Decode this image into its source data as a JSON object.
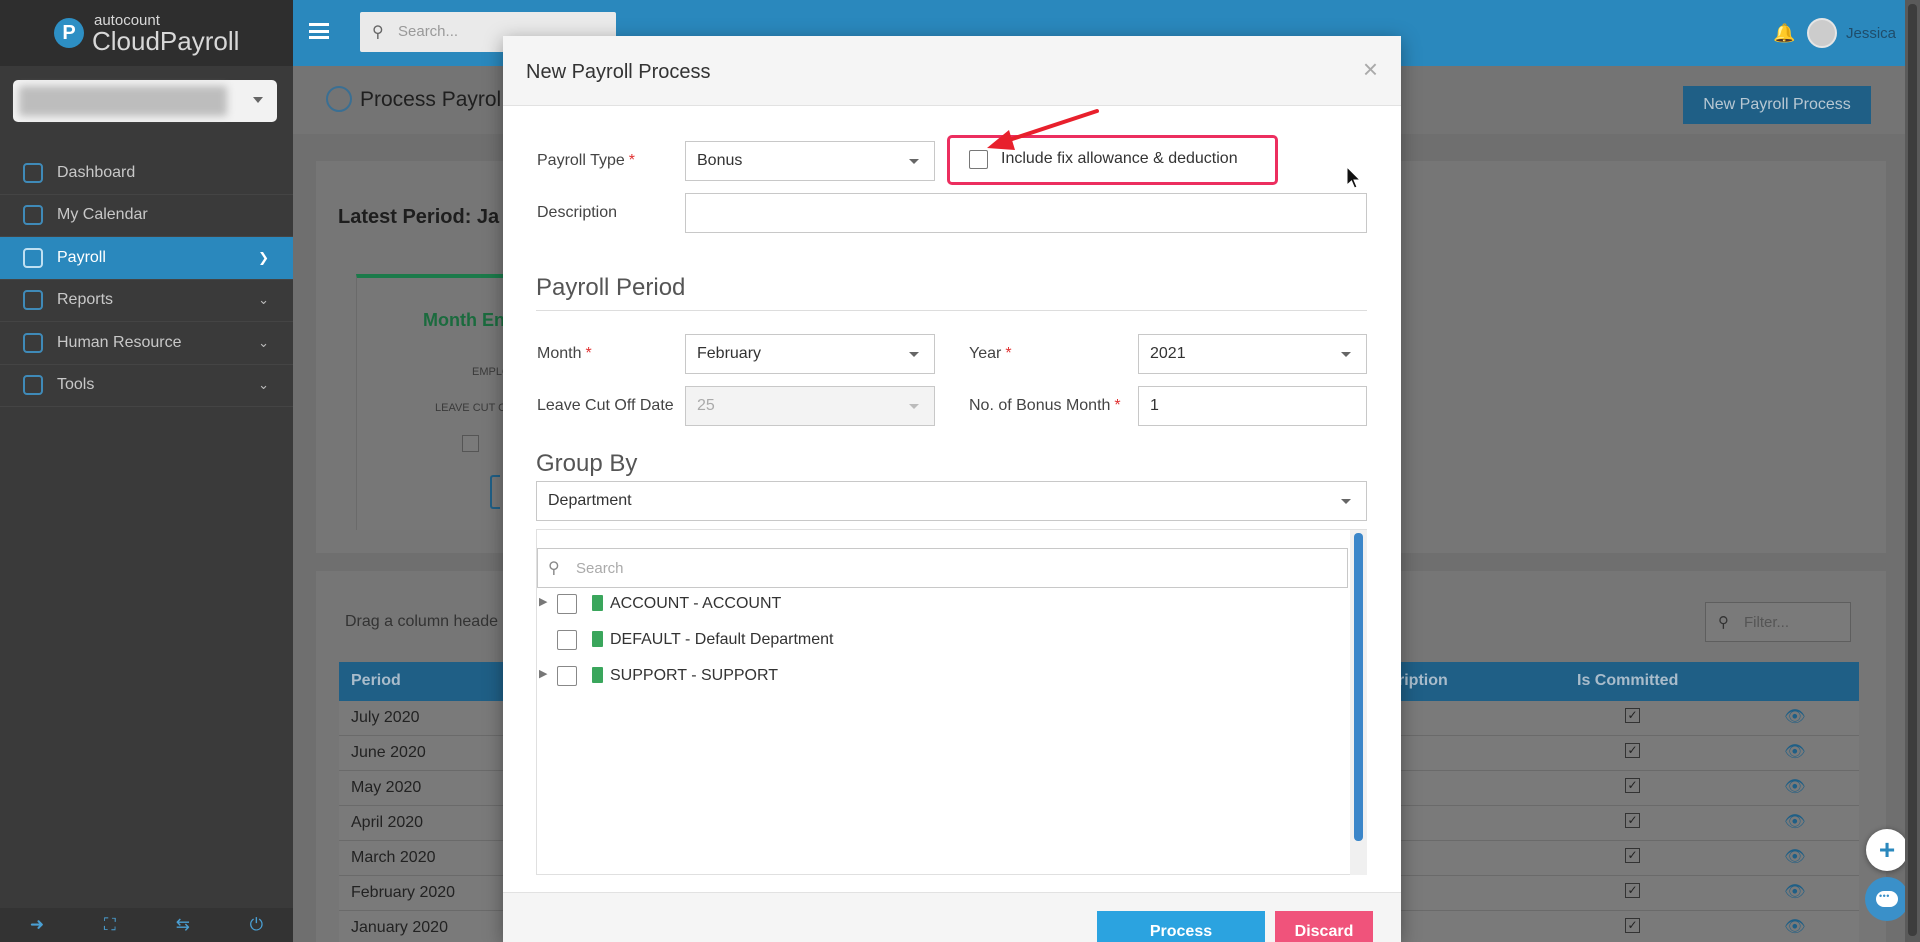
{
  "app": {
    "logo_small": "autocount",
    "logo_big": "CloudPayroll",
    "user_name": "Jessica"
  },
  "topbar": {
    "search_placeholder": "Search..."
  },
  "sidebar": {
    "items": [
      {
        "label": "Dashboard"
      },
      {
        "label": "My Calendar"
      },
      {
        "label": "Payroll"
      },
      {
        "label": "Reports"
      },
      {
        "label": "Human Resource"
      },
      {
        "label": "Tools"
      }
    ]
  },
  "page": {
    "title": "Process Payrol",
    "new_button": "New Payroll Process",
    "latest_period": "Latest Period: Ja",
    "month_end": "Month En",
    "employee_label": "EMPLO",
    "leave_cut_label": "LEAVE CUT O",
    "is_label": "Is",
    "drag_hint": "Drag a column heade",
    "filter_placeholder": "Filter...",
    "grid": {
      "col_period": "Period",
      "col_description": "ription",
      "col_committed": "Is Committed",
      "rows": [
        {
          "period": "July 2020",
          "committed": "✓"
        },
        {
          "period": "June 2020",
          "committed": "✓"
        },
        {
          "period": "May 2020",
          "committed": "✓"
        },
        {
          "period": "April 2020",
          "committed": "✓"
        },
        {
          "period": "March 2020",
          "committed": "✓"
        },
        {
          "period": "February 2020",
          "committed": "✓"
        },
        {
          "period": "January 2020",
          "committed": "✓"
        }
      ]
    }
  },
  "modal": {
    "title": "New Payroll Process",
    "close": "×",
    "payroll_type_label": "Payroll Type",
    "payroll_type_value": "Bonus",
    "include_fix_label": "Include fix allowance & deduction",
    "description_label": "Description",
    "description_value": "",
    "payroll_period_title": "Payroll Period",
    "month_label": "Month",
    "month_value": "February",
    "year_label": "Year",
    "year_value": "2021",
    "leave_cutoff_label": "Leave Cut Off Date",
    "leave_cutoff_value": "25",
    "bonus_month_label": "No. of Bonus Month",
    "bonus_month_value": "1",
    "group_by_title": "Group By",
    "group_by_value": "Department",
    "tree_search_placeholder": "Search",
    "tree": [
      {
        "label": "ACCOUNT - ACCOUNT",
        "expandable": true
      },
      {
        "label": "DEFAULT - Default Department",
        "expandable": false
      },
      {
        "label": "SUPPORT - SUPPORT",
        "expandable": true
      }
    ],
    "process_button": "Process",
    "discard_button": "Discard",
    "required_mark": "*"
  },
  "colors": {
    "brand": "#2a88bd",
    "highlight_box": "#ec2e5f",
    "process": "#2ba3e0",
    "discard": "#f0537b"
  }
}
